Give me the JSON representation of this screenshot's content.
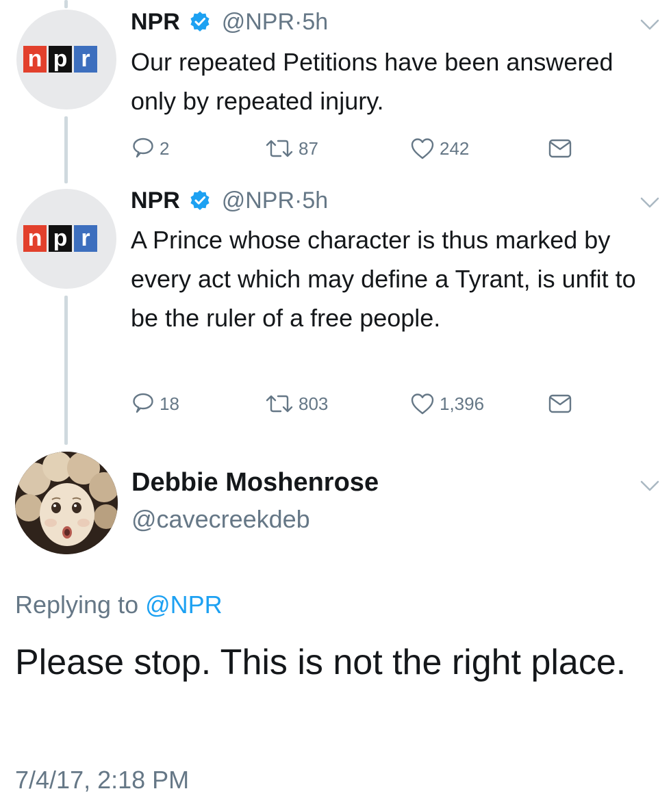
{
  "tweets": [
    {
      "name": "NPR",
      "handle": "@NPR",
      "separator": "·",
      "time": "5h",
      "avatar_logo": [
        "n",
        "p",
        "r"
      ],
      "text": "Our repeated Petitions have been answered only by repeated injury.",
      "replies": "2",
      "retweets": "87",
      "likes": "242"
    },
    {
      "name": "NPR",
      "handle": "@NPR",
      "separator": "·",
      "time": "5h",
      "avatar_logo": [
        "n",
        "p",
        "r"
      ],
      "text": "A Prince whose character is thus marked by every act which may define a Tyrant, is unfit to be the ruler of a free people.",
      "replies": "18",
      "retweets": "803",
      "likes": "1,396"
    }
  ],
  "reply": {
    "name": "Debbie Moshenrose",
    "handle": "@cavecreekdeb",
    "replying_prefix": "Replying to",
    "replying_to": "@NPR",
    "text": "Please stop. This is not the right place.",
    "timestamp": "7/4/17, 2:18 PM"
  },
  "colors": {
    "primary_text": "#14171a",
    "secondary_text": "#657786",
    "link": "#1da1f2",
    "verified": "#1da1f2",
    "thread_line": "#cfd9de",
    "npr_n": "#e2402c",
    "npr_p": "#111111",
    "npr_r": "#3d6fbe"
  },
  "icons": {
    "reply": "reply-icon",
    "retweet": "retweet-icon",
    "like": "like-icon",
    "dm": "direct-message-icon",
    "menu": "chevron-down-icon",
    "verified": "verified-badge-icon"
  }
}
